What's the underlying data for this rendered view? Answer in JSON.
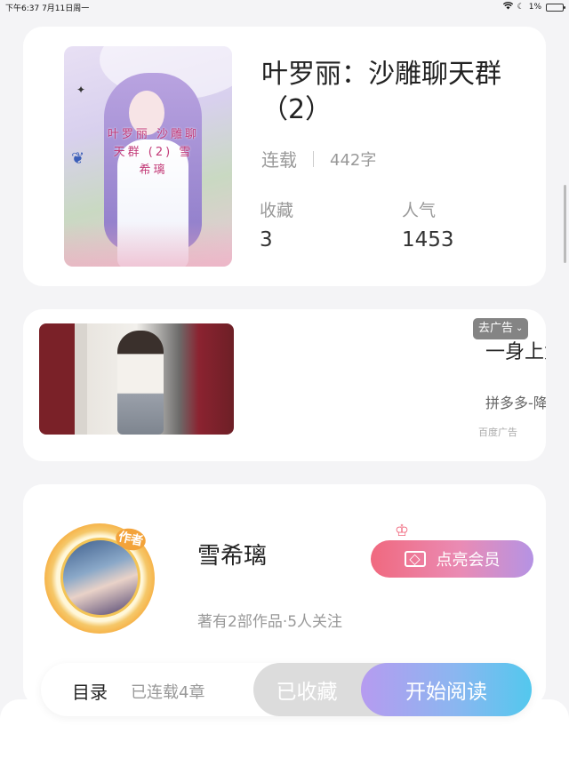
{
  "status_bar": {
    "time_date": "下午6:37   7月11日周一",
    "battery_text": "1%"
  },
  "book": {
    "title": "叶罗丽：沙雕聊天群（2）",
    "status": "连载",
    "word_count": "442字",
    "cover_text": "叶罗丽 沙雕聊天群 (2) 雪希璃",
    "stats": [
      {
        "label": "收藏",
        "value": "3"
      },
      {
        "label": "人气",
        "value": "1453"
      }
    ]
  },
  "ad": {
    "remove_label": "去广告",
    "headline": "一身上太",
    "subtitle": "拼多多-降价",
    "source": "百度广告"
  },
  "author": {
    "tag": "作者",
    "name": "雪希璃",
    "info": "著有2部作品·5人关注",
    "vip_button": "点亮会员"
  },
  "action_bar": {
    "toc_label": "目录",
    "chapters_label": "已连载4章",
    "favorited_label": "已收藏",
    "read_label": "开始阅读"
  },
  "colors": {
    "vip_gradient": [
      "#f0697f",
      "#b593e4"
    ],
    "read_gradient": [
      "#b69bf0",
      "#53c8ee"
    ],
    "favorited_bg": "#dcdcdc"
  }
}
